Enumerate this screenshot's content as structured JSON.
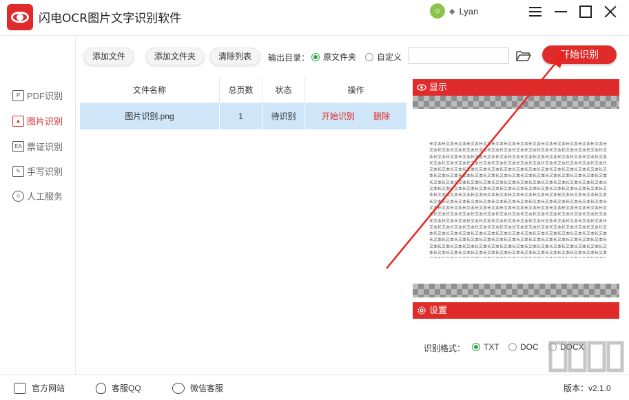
{
  "app": {
    "title": "闪电OCR图片文字识别软件"
  },
  "user": {
    "name": "Lyan",
    "vip_icon": "diamond-icon"
  },
  "sidebar": {
    "items": [
      {
        "label": "PDF识别",
        "icon": "pdf-icon",
        "active": false
      },
      {
        "label": "图片识别",
        "icon": "image-icon",
        "active": true
      },
      {
        "label": "票证识别",
        "icon": "id-card-icon",
        "active": false
      },
      {
        "label": "手写识别",
        "icon": "handwriting-icon",
        "active": false
      },
      {
        "label": "人工服务",
        "icon": "smiley-icon",
        "active": false
      }
    ]
  },
  "toolbar": {
    "add_file": "添加文件",
    "add_folder": "添加文件夹",
    "clear_list": "清除列表",
    "output_label": "输出目录：",
    "output_options": [
      "原文件夹",
      "自定义"
    ],
    "output_selected": "原文件夹",
    "path_value": "",
    "start_label": "开始识别"
  },
  "table": {
    "headers": [
      "文件名称",
      "总页数",
      "状态",
      "操作"
    ],
    "rows": [
      {
        "name": "图片识别.png",
        "pages": "1",
        "status": "待识别",
        "start": "开始识别",
        "delete": "删除"
      }
    ]
  },
  "preview": {
    "title": "显示",
    "sample_text": "长文本长文本长文本长文本长文本长文本长文本长文本长文本长文本长文本长文本长文本长文本长文本长文本长文本长文本长文本长文本长文本长文本长文本长文本长文本长文本长文本长文本长文本长文本长文本长文本长文本长文本长文本长文本长文本长文本长文本长文本长文本长文本长文本长文本长文本长文本长文本长文本长文本长文本长文本长文本长文本长文本长文本长文本长文本长文本长文本长文本长文本长文本长文本长文本长文本长文本长文本长文本长文本长文本长文本长文本长文本长文本长文本长文本长文本长文本长文本长文本长文本长文本长文本长文本长文本长文本长文本长文本长文本长文本长文本长文本长文本长文本长文本长文本长文本长文本长文本长文本长文本长文本长文本长文本长文本长文本长文本长文本长文本长文本长文本长文本长文本长文本长文本长文本长文本长文本长文本长文本长文本长文本长文本长文本长文本长文本长文本长文本长文本长文本长文本长文本长文本长文本长文本长文本长文本长文本长文本长文本长文本长文本长文本长文本长文本长文本长文本长文本长文本长文本长文本长文本长文本长文本长文本长文本长文本长文本长文本长文本长文本长文本长文本长文本长文本长文本长文本长文本长文本长文本长文本长文本长文本长文本长文本长文本长文本长文本长文本长文本长文本长文本长文本长文本长文本长文本长文本长文本长文本长文本长文本长文本长文本长文本长文本长文本长文本长文本长文本长文本长文本长文本长文本长文本长文本长文本长文本长文本长文本长文本长文本长文本长文本长文本长文本长文本长文本长文本长文本长文本长文本长文本长文本长文本长文本长文本长文本长文本长文本长文本长文本长文本长文本长文本长文本长文本长文本长文本长文本长文本长文本长文本长文本长文本长文本长文本长文本长文本长文本长文本长文本长文本长文本长文本长文本长文本长文本长文本长文本长文本长文本长文本长文本长文本长文本长文本长文本长文本长文本长文本长文本长文本长文本长文本长文本长文本长文本长文本长文本长文本长文本长文本长文本长文本长文本长文本长文本长文本长文本长文本长文本长文本"
  },
  "settings": {
    "title": "设置",
    "format_label": "识别格式：",
    "formats": [
      "TXT",
      "DOC",
      "DOCX"
    ],
    "selected_format": "TXT"
  },
  "footer": {
    "website": "官方网站",
    "qq": "客服QQ",
    "wechat": "微信客服",
    "version": "版本：v2.1.0"
  },
  "colors": {
    "accent": "#e02b2b",
    "selected_row": "#cfe6f8",
    "radio_checked": "#2ea44f"
  }
}
